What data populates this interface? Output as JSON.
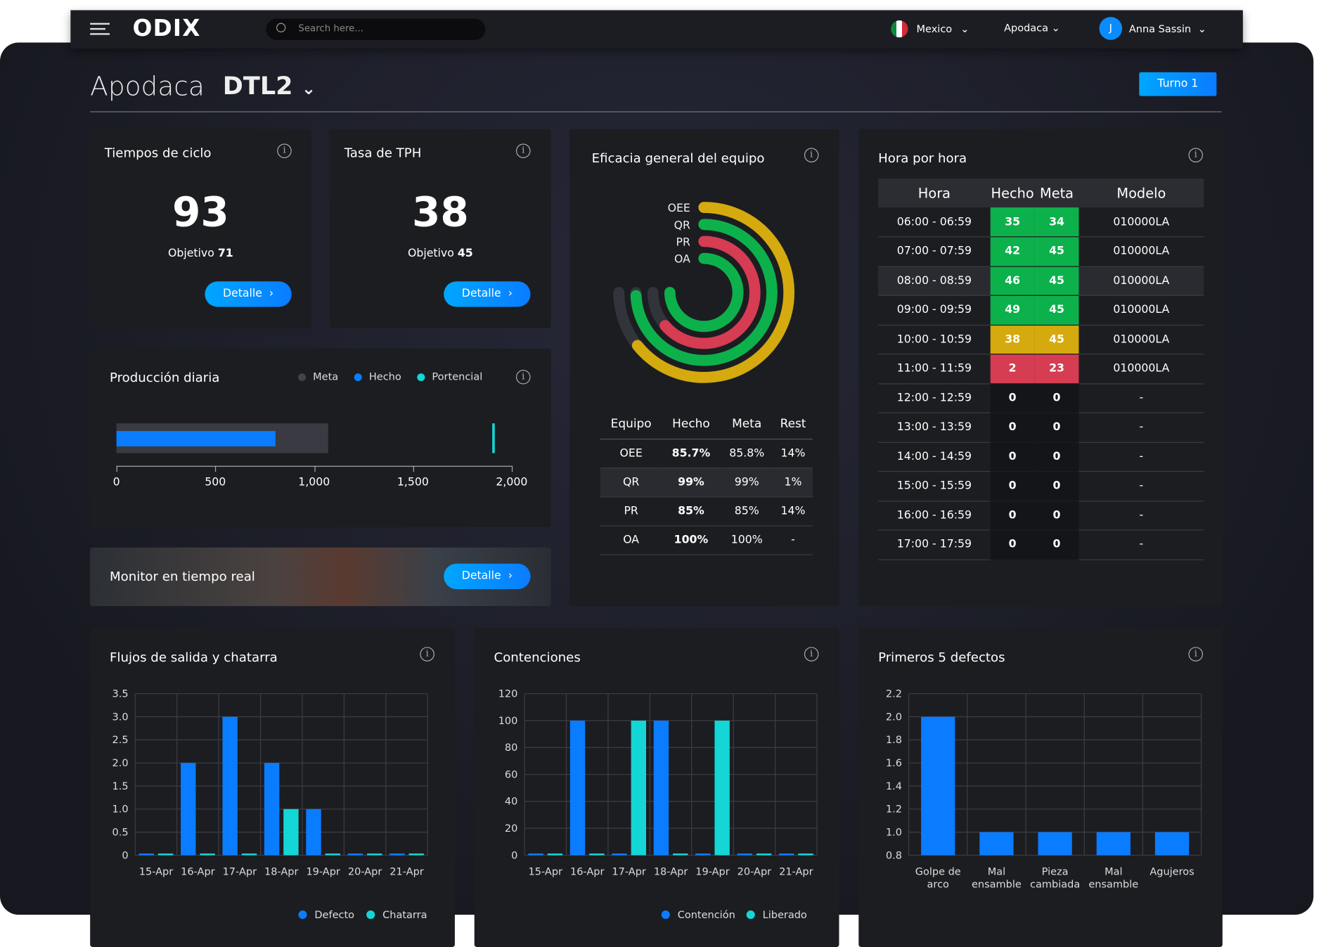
{
  "nav": {
    "search_placeholder": "Search here...",
    "country": "Mexico",
    "site": "Apodaca",
    "user": "Anna Sassin",
    "user_initial": "J",
    "logo": "ODIX"
  },
  "header": {
    "site": "Apodaca",
    "line": "DTL2",
    "shift": "Turno 1"
  },
  "cycle": {
    "title": "Tiempos de ciclo",
    "value": "93",
    "objective_label": "Objetivo",
    "objective": "71",
    "button": "Detalle"
  },
  "tph": {
    "title": "Tasa de TPH",
    "value": "38",
    "objective_label": "Objetivo",
    "objective": "45",
    "button": "Detalle"
  },
  "production": {
    "title": "Producción diaria",
    "legend": [
      "Meta",
      "Hecho",
      "Portencial"
    ],
    "ticks": [
      "0",
      "500",
      "1,000",
      "1,500",
      "2,000"
    ],
    "max": 2000,
    "meta": 1070,
    "hecho": 805,
    "potencial": 1900
  },
  "monitor": {
    "title": "Monitor en tiempo real",
    "button": "Detalle"
  },
  "oee": {
    "title": "Eficacia general del equipo",
    "rings": [
      {
        "label": "OEE",
        "value": 0.857,
        "color": "#d4aa0f"
      },
      {
        "label": "QR",
        "value": 0.99,
        "color": "#0db14b"
      },
      {
        "label": "PR",
        "value": 0.85,
        "color": "#d63c52"
      },
      {
        "label": "OA",
        "value": 1.0,
        "color": "#0db14b"
      }
    ],
    "columns": [
      "Equipo",
      "Hecho",
      "Meta",
      "Rest"
    ],
    "rows": [
      [
        "OEE",
        "85.7%",
        "85.8%",
        "14%"
      ],
      [
        "QR",
        "99%",
        "99%",
        "1%"
      ],
      [
        "PR",
        "85%",
        "85%",
        "14%"
      ],
      [
        "OA",
        "100%",
        "100%",
        "-"
      ]
    ]
  },
  "hourly": {
    "title": "Hora por hora",
    "columns": [
      "Hora",
      "Hecho",
      "Meta",
      "Modelo"
    ],
    "rows": [
      {
        "hora": "06:00 - 06:59",
        "hecho": "35",
        "meta": "34",
        "modelo": "010000LA",
        "status": "green"
      },
      {
        "hora": "07:00 - 07:59",
        "hecho": "42",
        "meta": "45",
        "modelo": "010000LA",
        "status": "green"
      },
      {
        "hora": "08:00 - 08:59",
        "hecho": "46",
        "meta": "45",
        "modelo": "010000LA",
        "status": "green"
      },
      {
        "hora": "09:00 - 09:59",
        "hecho": "49",
        "meta": "45",
        "modelo": "010000LA",
        "status": "green"
      },
      {
        "hora": "10:00 - 10:59",
        "hecho": "38",
        "meta": "45",
        "modelo": "010000LA",
        "status": "yellow"
      },
      {
        "hora": "11:00 - 11:59",
        "hecho": "2",
        "meta": "23",
        "modelo": "010000LA",
        "status": "red"
      },
      {
        "hora": "12:00 - 12:59",
        "hecho": "0",
        "meta": "0",
        "modelo": "-",
        "status": "none"
      },
      {
        "hora": "13:00 - 13:59",
        "hecho": "0",
        "meta": "0",
        "modelo": "-",
        "status": "none"
      },
      {
        "hora": "14:00 - 14:59",
        "hecho": "0",
        "meta": "0",
        "modelo": "-",
        "status": "none"
      },
      {
        "hora": "15:00 - 15:59",
        "hecho": "0",
        "meta": "0",
        "modelo": "-",
        "status": "none"
      },
      {
        "hora": "16:00 - 16:59",
        "hecho": "0",
        "meta": "0",
        "modelo": "-",
        "status": "none"
      },
      {
        "hora": "17:00 - 17:59",
        "hecho": "0",
        "meta": "0",
        "modelo": "-",
        "status": "none"
      }
    ]
  },
  "colors": {
    "green": "#0db14b",
    "yellow": "#d4aa0f",
    "red": "#d63c52",
    "blue": "#0a7cff",
    "cyan": "#14d6d6"
  },
  "chart_data": [
    {
      "type": "bar",
      "title": "Flujos de salida y chatarra",
      "categories": [
        "15-Apr",
        "16-Apr",
        "17-Apr",
        "18-Apr",
        "19-Apr",
        "20-Apr",
        "21-Apr"
      ],
      "series": [
        {
          "name": "Defecto",
          "values": [
            0,
            2,
            3,
            2,
            1,
            0,
            0
          ]
        },
        {
          "name": "Chatarra",
          "values": [
            0,
            0,
            0,
            1,
            0,
            0,
            0
          ]
        }
      ],
      "ylim": [
        0,
        3.5
      ],
      "yticks": [
        "0",
        "0.5",
        "1.0",
        "1.5",
        "2.0",
        "2.5",
        "3.0",
        "3.5"
      ]
    },
    {
      "type": "bar",
      "title": "Contenciones",
      "categories": [
        "15-Apr",
        "16-Apr",
        "17-Apr",
        "18-Apr",
        "19-Apr",
        "20-Apr",
        "21-Apr"
      ],
      "series": [
        {
          "name": "Contención",
          "values": [
            0,
            100,
            0,
            100,
            0,
            0,
            0
          ]
        },
        {
          "name": "Liberado",
          "values": [
            0,
            0,
            100,
            0,
            100,
            0,
            0
          ]
        }
      ],
      "ylim": [
        0,
        120
      ],
      "yticks": [
        "0",
        "20",
        "40",
        "60",
        "80",
        "100",
        "120"
      ]
    },
    {
      "type": "bar",
      "title": "Primeros 5 defectos",
      "categories": [
        "Golpe de arco",
        "Mal ensamble",
        "Pieza cambiada",
        "Mal ensamble",
        "Agujeros"
      ],
      "series": [
        {
          "name": "Defectos",
          "values": [
            2.0,
            1.0,
            1.0,
            1.0,
            1.0
          ]
        }
      ],
      "ylim": [
        0.8,
        2.2
      ],
      "yticks": [
        "0.8",
        "1.0",
        "1.2",
        "1.4",
        "1.6",
        "1.8",
        "2.0",
        "2.2"
      ]
    }
  ]
}
